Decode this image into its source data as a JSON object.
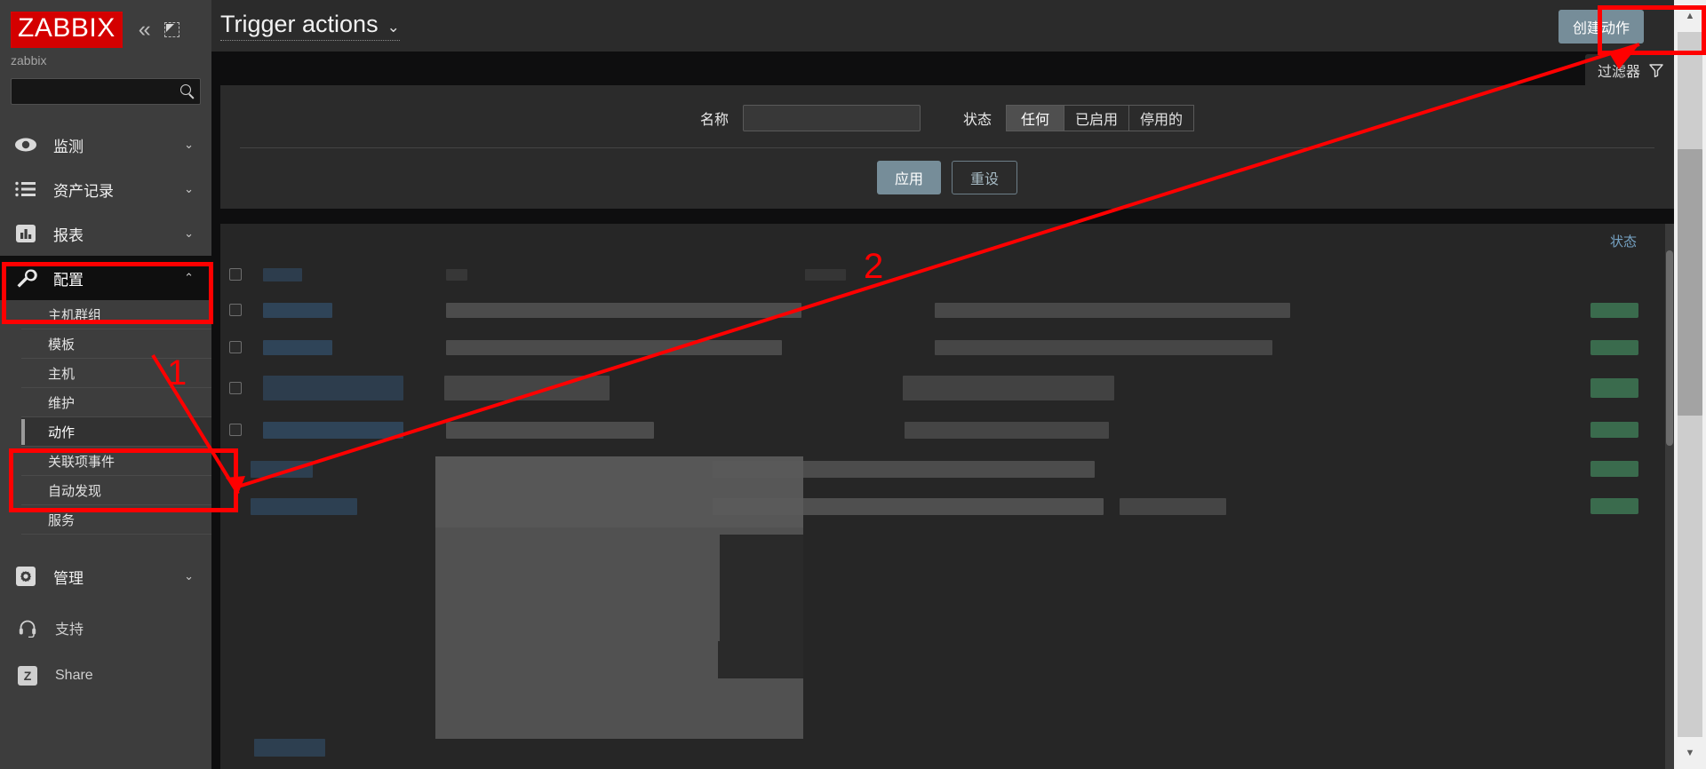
{
  "sidebar": {
    "logo_text": "ZABBIX",
    "server_name": "zabbix",
    "collapse_label": "«",
    "compact_label": "compact-view",
    "search_placeholder": "",
    "search_value": "",
    "menu": [
      {
        "label": "监测",
        "icon": "eye-icon",
        "has_chevron": true,
        "chevron": "⌄",
        "selected": false
      },
      {
        "label": "资产记录",
        "icon": "list-icon",
        "has_chevron": true,
        "chevron": "⌄",
        "selected": false
      },
      {
        "label": "报表",
        "icon": "bar-chart-icon",
        "has_chevron": true,
        "chevron": "⌄",
        "selected": false
      },
      {
        "label": "配置",
        "icon": "wrench-icon",
        "has_chevron": true,
        "chevron": "⌃",
        "selected": true
      }
    ],
    "submenu": [
      {
        "label": "主机群组",
        "active": false
      },
      {
        "label": "模板",
        "active": false
      },
      {
        "label": "主机",
        "active": false
      },
      {
        "label": "维护",
        "active": false
      },
      {
        "label": "动作",
        "active": true
      },
      {
        "label": "关联项事件",
        "active": false
      },
      {
        "label": "自动发现",
        "active": false
      },
      {
        "label": "服务",
        "active": false
      }
    ],
    "admin": {
      "label": "管理",
      "icon": "gear-icon",
      "chevron": "⌄"
    },
    "footer": [
      {
        "label": "支持",
        "icon": "headset-icon"
      },
      {
        "label": "Share",
        "icon": "zabbix-z-icon"
      }
    ]
  },
  "header": {
    "title": "Trigger actions",
    "title_chevron": "⌄",
    "create_button": "创建动作"
  },
  "filter": {
    "tab_label": "过滤器",
    "tab_icon": "funnel-icon",
    "name_label": "名称",
    "name_value": "",
    "name_placeholder": "",
    "status_label": "状态",
    "status_options": [
      {
        "label": "任何",
        "selected": true
      },
      {
        "label": "已启用",
        "selected": false
      },
      {
        "label": "停用的",
        "selected": false
      }
    ],
    "apply_button": "应用",
    "reset_button": "重设"
  },
  "table": {
    "status_column_header": "状态",
    "rows_redacted": true,
    "row_count": 7
  },
  "annotations": {
    "marker_1": "1",
    "marker_2": "2",
    "highlight_color": "#ff0000"
  },
  "colors": {
    "brand_red": "#d40000",
    "accent_button": "#768d99",
    "link_blue": "#76a3c4",
    "status_green": "#3a6b4d",
    "sidebar_bg": "#3d3d3d",
    "main_bg": "#0e0e0f",
    "panel_bg": "#2b2b2b"
  }
}
